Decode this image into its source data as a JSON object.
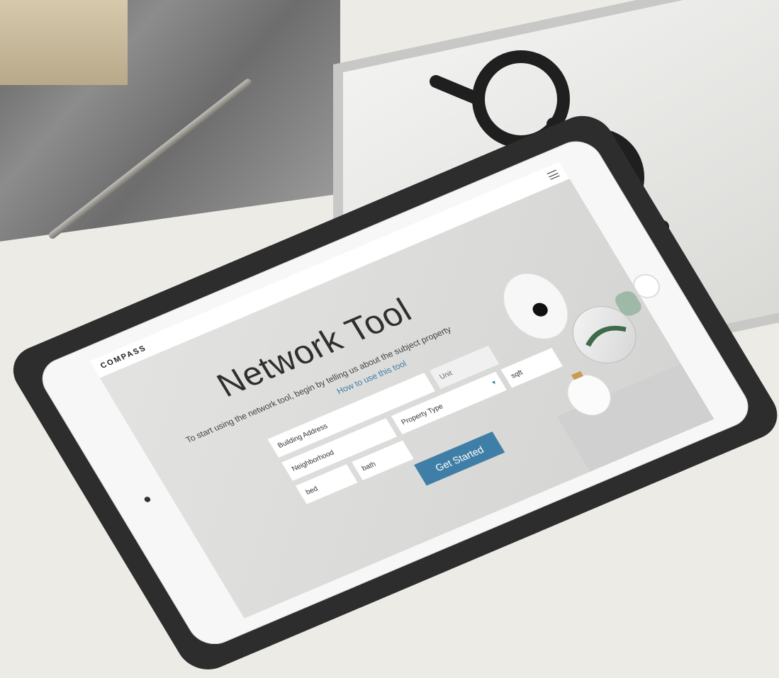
{
  "screen": {
    "logo": "COMPASS",
    "title": "Network Tool",
    "subtitle": "To start using the network tool, begin by telling us about the subject property",
    "how_to": "How to use this tool",
    "fields": {
      "building_address_placeholder": "Building Address",
      "unit_placeholder": "Unit",
      "neighborhood_placeholder": "Neighborhood",
      "property_type_placeholder": "Property Type",
      "sqft_placeholder": "sqft",
      "bed_placeholder": "bed",
      "bath_placeholder": "bath"
    },
    "cta_label": "Get Started",
    "colors": {
      "accent": "#3f7ea6"
    },
    "icons": {
      "menu": "hamburger-menu-icon",
      "dropdown": "chevron-down-icon"
    }
  }
}
